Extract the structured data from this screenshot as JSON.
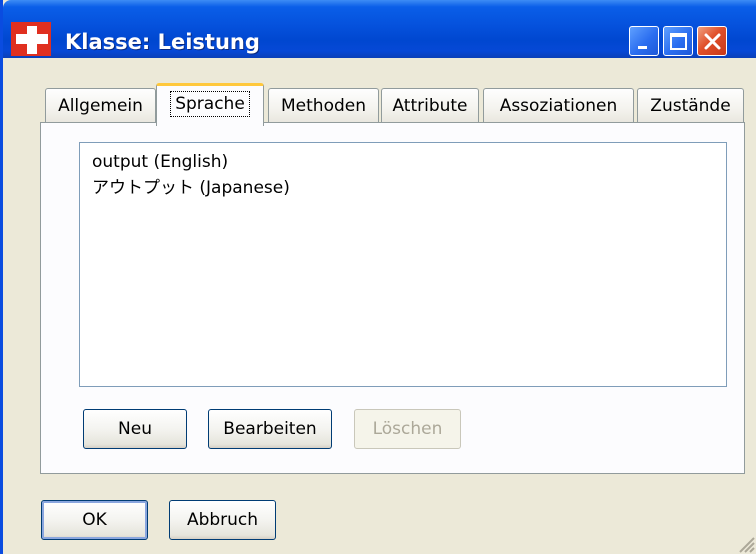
{
  "window": {
    "title": "Klasse: Leistung"
  },
  "tabs": [
    {
      "label": "Allgemein"
    },
    {
      "label": "Sprache",
      "active": true
    },
    {
      "label": "Methoden"
    },
    {
      "label": "Attribute"
    },
    {
      "label": "Assoziationen"
    },
    {
      "label": "Zustände"
    }
  ],
  "language_list": {
    "items": [
      "output (English)",
      "アウトプット (Japanese)"
    ]
  },
  "panel_buttons": {
    "new_label": "Neu",
    "edit_label": "Bearbeiten",
    "delete_label": "Löschen"
  },
  "dialog_buttons": {
    "ok_label": "OK",
    "cancel_label": "Abbruch"
  },
  "icons": {
    "app": "swiss-cross-icon",
    "minimize": "minimize-icon",
    "maximize": "maximize-icon",
    "close": "close-icon",
    "resize": "resize-grip-icon"
  },
  "colors": {
    "titlebar": "#0551dc",
    "window_bg": "#ece9d8",
    "active_tab_highlight": "#ffc83c",
    "close_button": "#e0502a"
  }
}
